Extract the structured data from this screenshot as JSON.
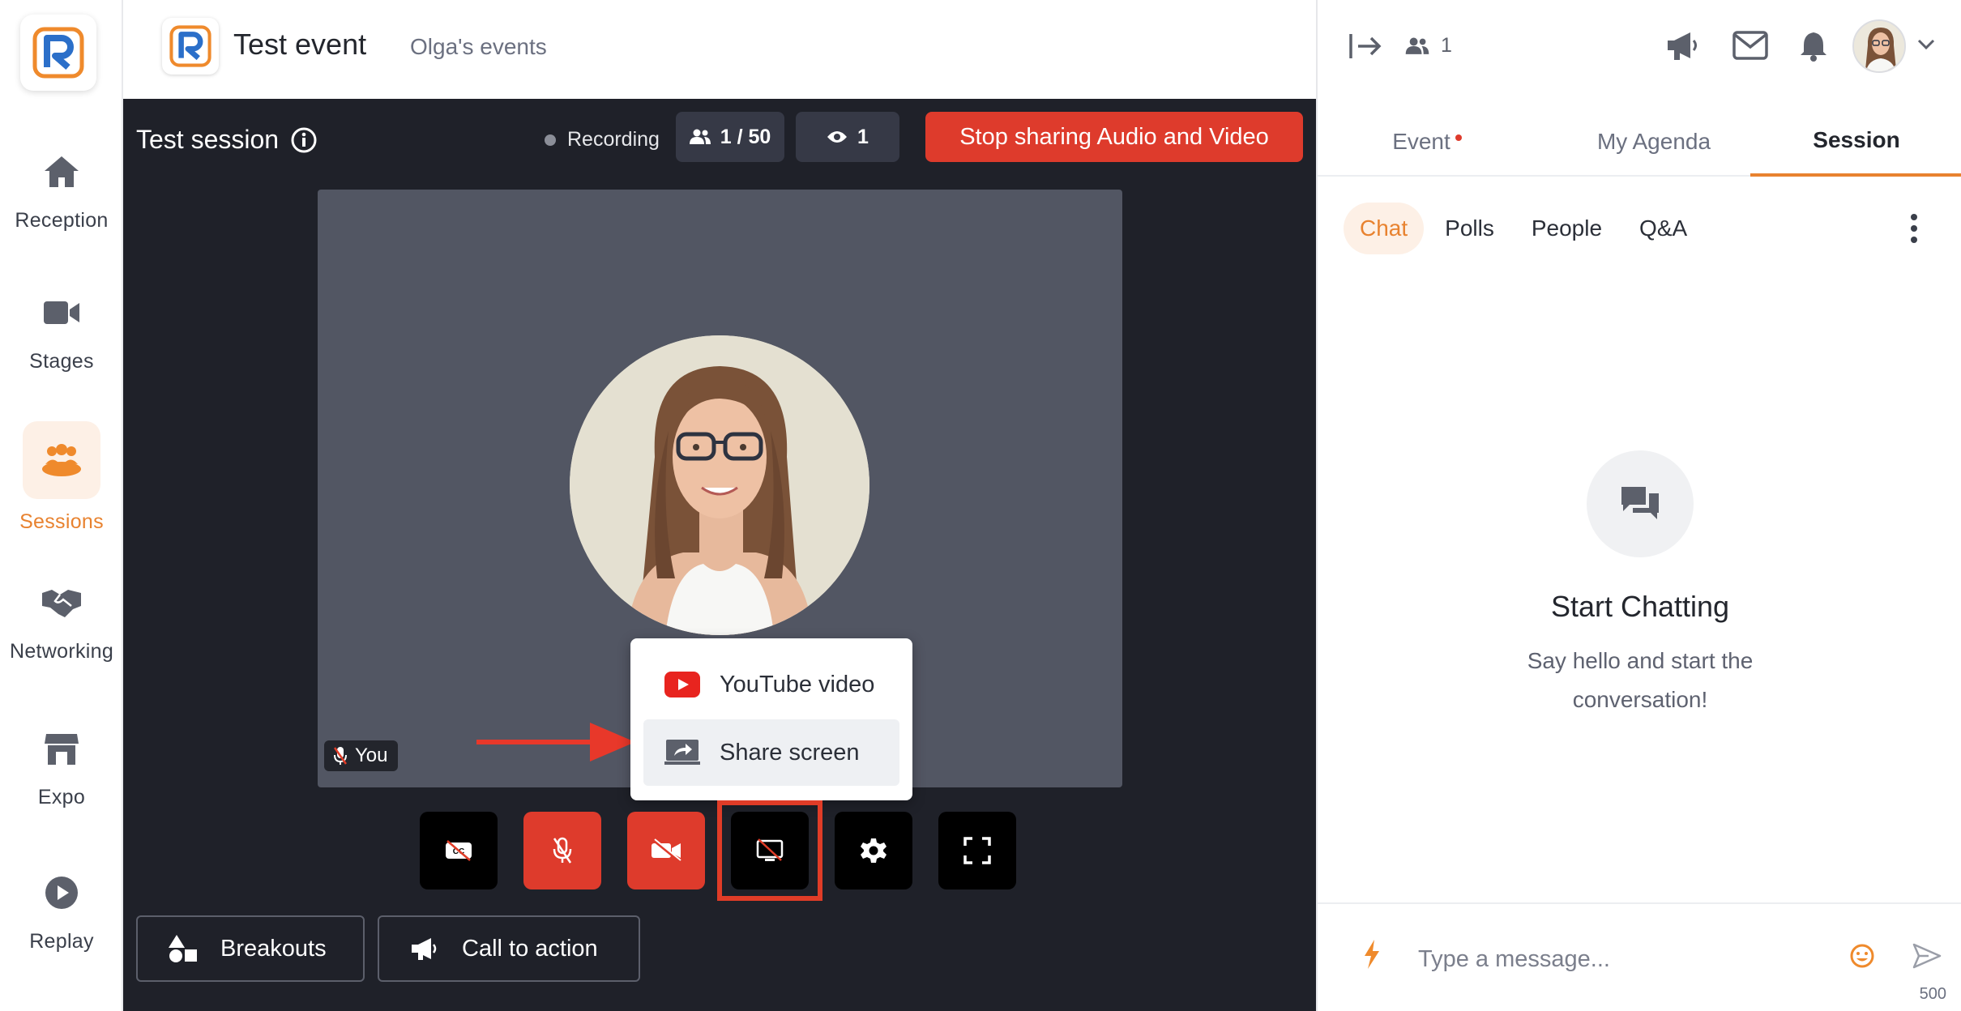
{
  "app": {
    "logo_letter": "R",
    "event_title": "Test event",
    "organizer": "Olga's events"
  },
  "nav": {
    "items": [
      {
        "label": "Reception",
        "icon": "home-icon",
        "active": false
      },
      {
        "label": "Stages",
        "icon": "video-camera-icon",
        "active": false
      },
      {
        "label": "Sessions",
        "icon": "people-group-icon",
        "active": true
      },
      {
        "label": "Networking",
        "icon": "handshake-icon",
        "active": false
      },
      {
        "label": "Expo",
        "icon": "storefront-icon",
        "active": false
      },
      {
        "label": "Replay",
        "icon": "play-circle-icon",
        "active": false
      }
    ]
  },
  "stage": {
    "session_title": "Test session",
    "recording_label": "Recording",
    "attendees": "1 / 50",
    "viewers": "1",
    "stop_button": "Stop sharing Audio and Video",
    "you_label": "You",
    "share_menu": {
      "youtube": "YouTube video",
      "share_screen": "Share screen"
    },
    "controls": [
      {
        "icon": "captions-off-icon",
        "state": "normal"
      },
      {
        "icon": "mic-off-icon",
        "state": "red"
      },
      {
        "icon": "camera-off-icon",
        "state": "red"
      },
      {
        "icon": "screen-share-off-icon",
        "state": "highlighted"
      },
      {
        "icon": "gear-icon",
        "state": "normal"
      },
      {
        "icon": "fullscreen-icon",
        "state": "normal"
      }
    ],
    "breakouts_label": "Breakouts",
    "cta_label": "Call to action"
  },
  "right_panel": {
    "online_count": "1",
    "tabs": {
      "event": "Event",
      "agenda": "My Agenda",
      "session": "Session",
      "active": "Session"
    },
    "sub_tabs": [
      "Chat",
      "Polls",
      "People",
      "Q&A"
    ],
    "active_sub_tab": "Chat",
    "empty_title": "Start Chatting",
    "empty_line1": "Say hello and start the",
    "empty_line2": "conversation!",
    "message_placeholder": "Type a message...",
    "char_limit": "500"
  },
  "colors": {
    "accent": "#e8822f",
    "danger": "#de3b2c",
    "stage_bg": "#1f2129",
    "video_bg": "#525663"
  }
}
